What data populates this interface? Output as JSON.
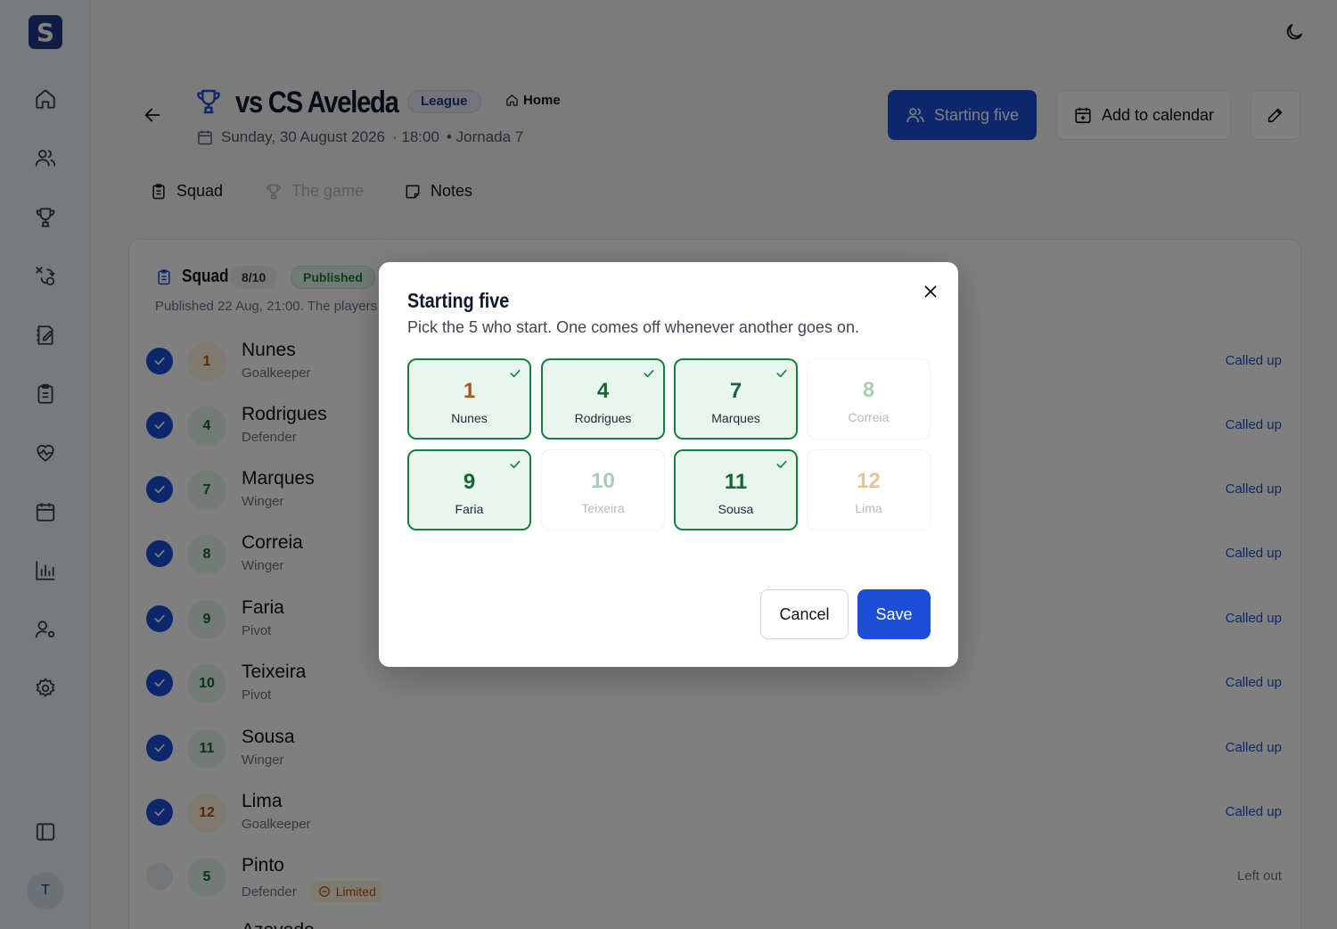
{
  "app": {
    "logo_letter": "S",
    "avatar_initial": "T"
  },
  "sidebar": {
    "icons": [
      "home-icon",
      "users-icon",
      "trophy-icon",
      "tactics-icon",
      "notebook-icon",
      "clipboard-icon",
      "heart-pulse-icon",
      "calendar-icon",
      "bar-chart-icon",
      "user-settings-icon",
      "settings-icon",
      "panel-toggle-icon"
    ]
  },
  "header": {
    "title": "vs CS Aveleda",
    "badge": "League",
    "venue": "Home",
    "date": "Sunday, 30 August 2026",
    "time": "· 18:00",
    "round": "• Jornada 7",
    "starting_five_label": "Starting five",
    "add_calendar_label": "Add to calendar"
  },
  "tabs": [
    {
      "label": "Squad",
      "enabled": true
    },
    {
      "label": "The game",
      "enabled": false
    },
    {
      "label": "Notes",
      "enabled": true
    }
  ],
  "squad": {
    "title": "Squad",
    "count": "8/10",
    "status": "Published",
    "published_note": "Published 22 Aug, 21:00. The players"
  },
  "players": [
    {
      "number": "1",
      "name": "Nunes",
      "role": "Goalkeeper",
      "status": "Called up",
      "called": true,
      "gk": true
    },
    {
      "number": "4",
      "name": "Rodrigues",
      "role": "Defender",
      "status": "Called up",
      "called": true,
      "gk": false
    },
    {
      "number": "7",
      "name": "Marques",
      "role": "Winger",
      "status": "Called up",
      "called": true,
      "gk": false
    },
    {
      "number": "8",
      "name": "Correia",
      "role": "Winger",
      "status": "Called up",
      "called": true,
      "gk": false
    },
    {
      "number": "9",
      "name": "Faria",
      "role": "Pivot",
      "status": "Called up",
      "called": true,
      "gk": false
    },
    {
      "number": "10",
      "name": "Teixeira",
      "role": "Pivot",
      "status": "Called up",
      "called": true,
      "gk": false
    },
    {
      "number": "11",
      "name": "Sousa",
      "role": "Winger",
      "status": "Called up",
      "called": true,
      "gk": false
    },
    {
      "number": "12",
      "name": "Lima",
      "role": "Goalkeeper",
      "status": "Called up",
      "called": true,
      "gk": true
    },
    {
      "number": "5",
      "name": "Pinto",
      "role": "Defender",
      "status": "Left out",
      "called": false,
      "gk": false,
      "tag": "Limited"
    },
    {
      "number": "",
      "name": "Azevedo",
      "role": "",
      "status": "",
      "called": false,
      "gk": false
    }
  ],
  "modal": {
    "title": "Starting five",
    "subtitle": "Pick the 5 who start. One comes off whenever another goes on.",
    "options": [
      {
        "number": "1",
        "name": "Nunes",
        "selected": true,
        "gk": true
      },
      {
        "number": "4",
        "name": "Rodrigues",
        "selected": true,
        "gk": false
      },
      {
        "number": "7",
        "name": "Marques",
        "selected": true,
        "gk": false
      },
      {
        "number": "8",
        "name": "Correia",
        "selected": false,
        "gk": false
      },
      {
        "number": "9",
        "name": "Faria",
        "selected": true,
        "gk": false
      },
      {
        "number": "10",
        "name": "Teixeira",
        "selected": false,
        "gk": false
      },
      {
        "number": "11",
        "name": "Sousa",
        "selected": true,
        "gk": false
      },
      {
        "number": "12",
        "name": "Lima",
        "selected": false,
        "gk": true
      }
    ],
    "cancel_label": "Cancel",
    "save_label": "Save"
  },
  "colors": {
    "accent": "#1d4ed8",
    "navy": "#1e3a8a",
    "success": "#15803d",
    "goalkeeper": "#b45309"
  }
}
